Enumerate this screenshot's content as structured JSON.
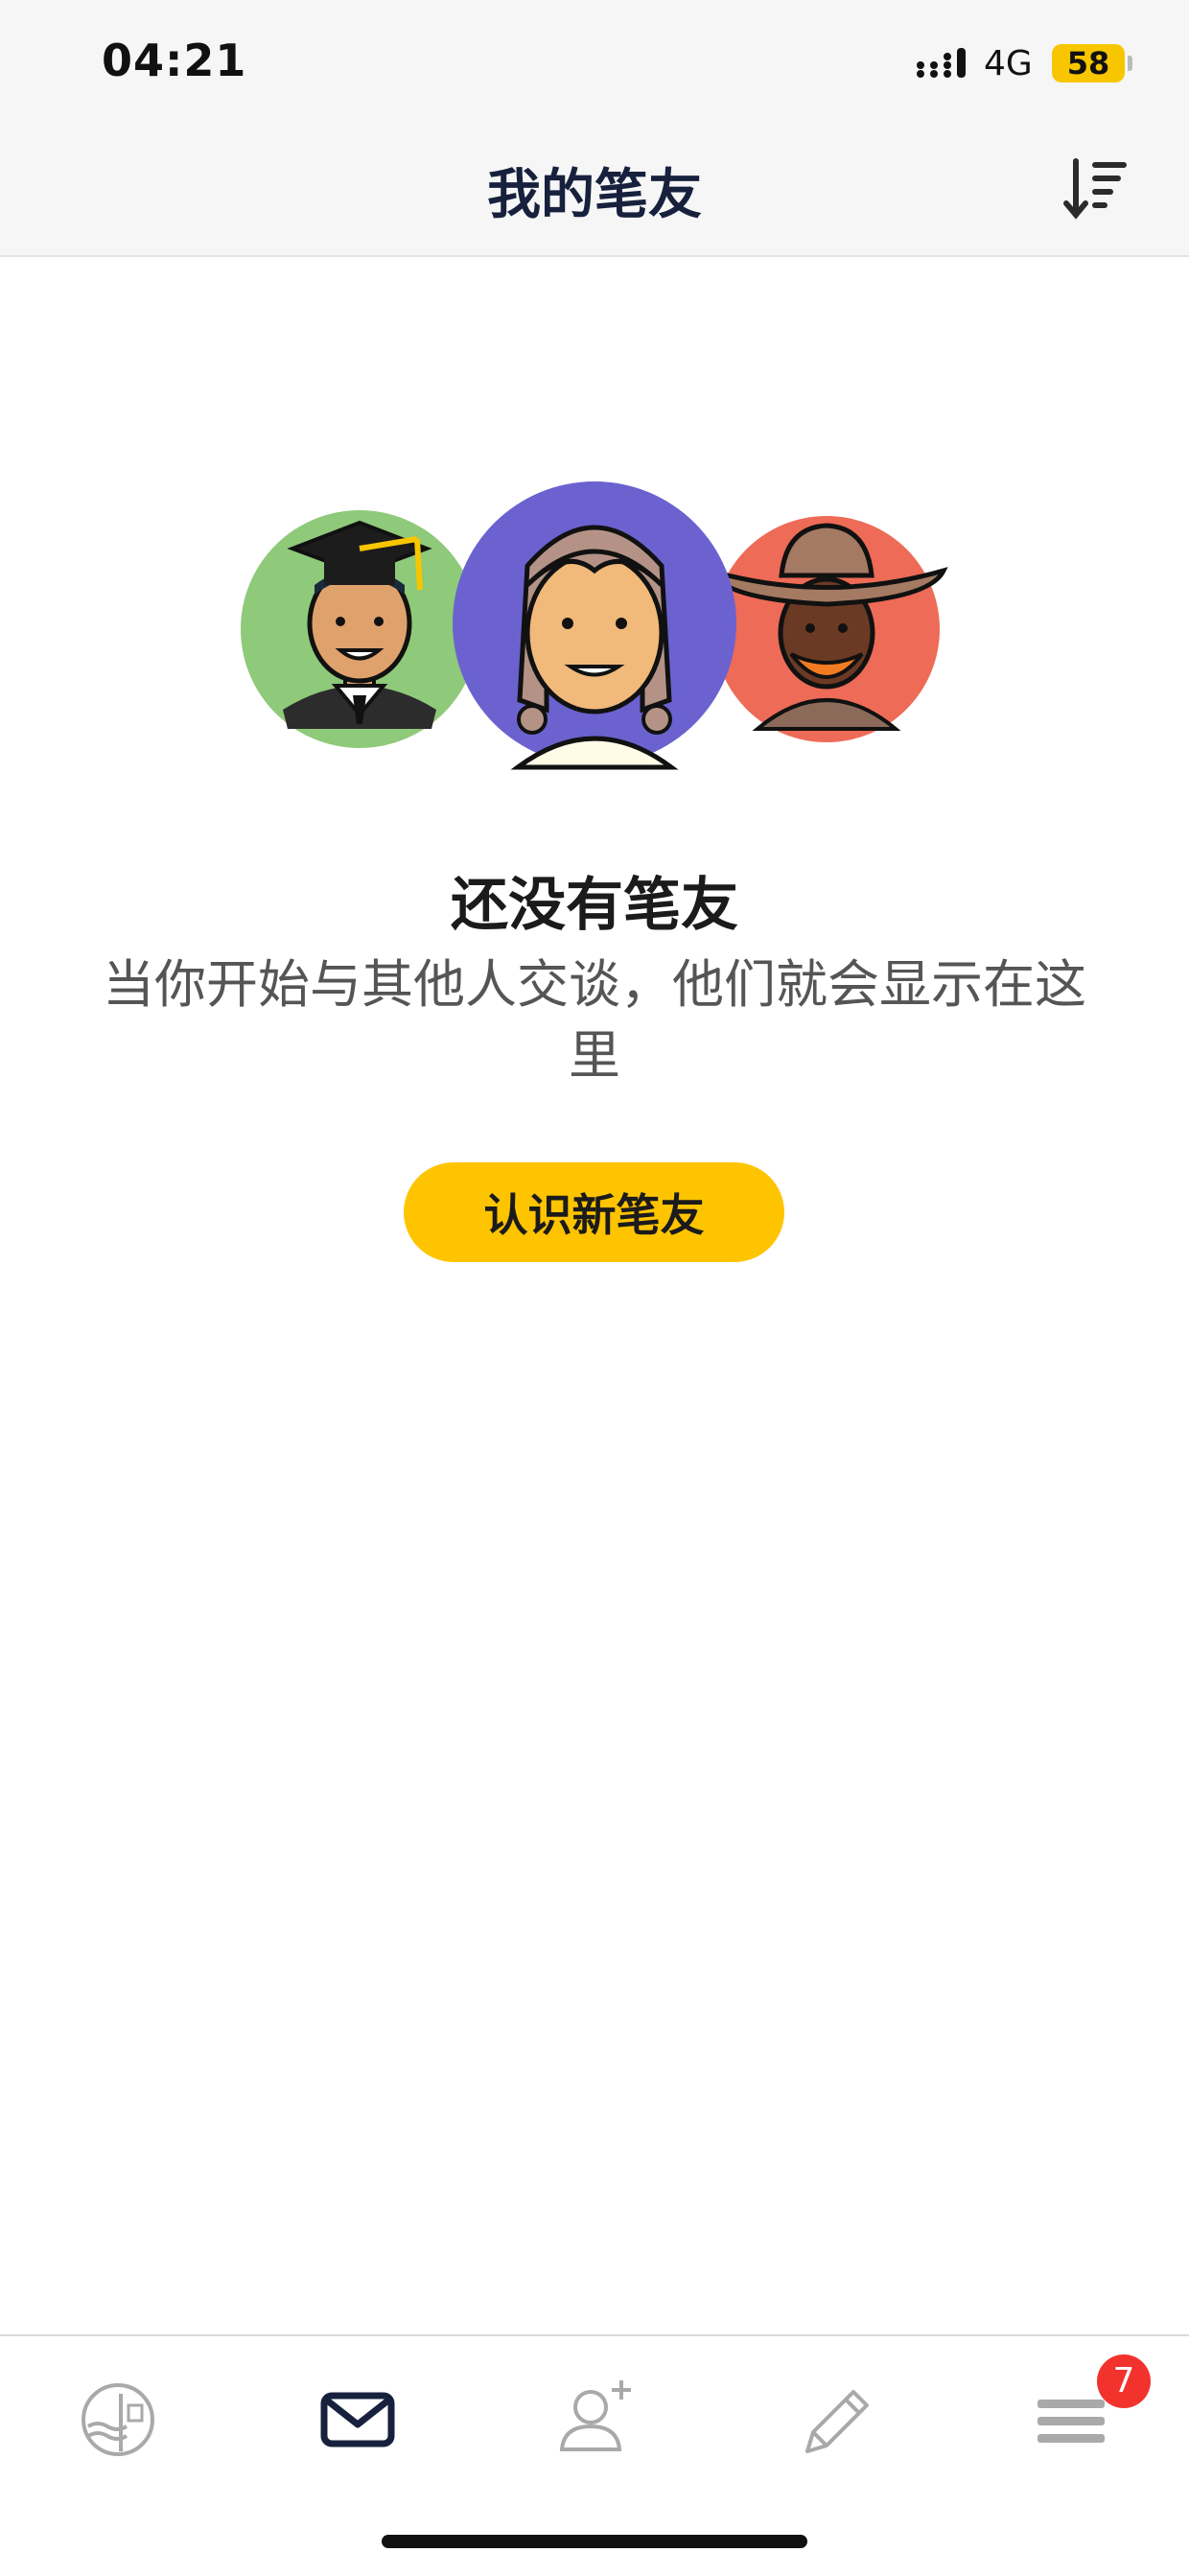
{
  "status_bar": {
    "time": "04:21",
    "network": "4G",
    "battery": "58"
  },
  "header": {
    "title": "我的笔友",
    "sort_icon": "sort-descending-icon"
  },
  "empty_state": {
    "title": "还没有笔友",
    "description": "当你开始与其他人交谈，他们就会显示在这里",
    "button_label": "认识新笔友",
    "avatars": [
      "graduate-avatar",
      "braided-girl-avatar",
      "cowboy-avatar"
    ]
  },
  "tab_bar": {
    "tabs": [
      {
        "name": "stamps",
        "icon": "stamp-globe-icon",
        "active": false
      },
      {
        "name": "letters",
        "icon": "envelope-icon",
        "active": true
      },
      {
        "name": "add-friend",
        "icon": "add-person-icon",
        "active": false
      },
      {
        "name": "write",
        "icon": "pencil-icon",
        "active": false
      },
      {
        "name": "menu",
        "icon": "menu-icon",
        "active": false
      }
    ],
    "menu_badge": "7"
  },
  "colors": {
    "accent": "#ffc400",
    "title": "#17213d",
    "badge": "#f2322d"
  }
}
